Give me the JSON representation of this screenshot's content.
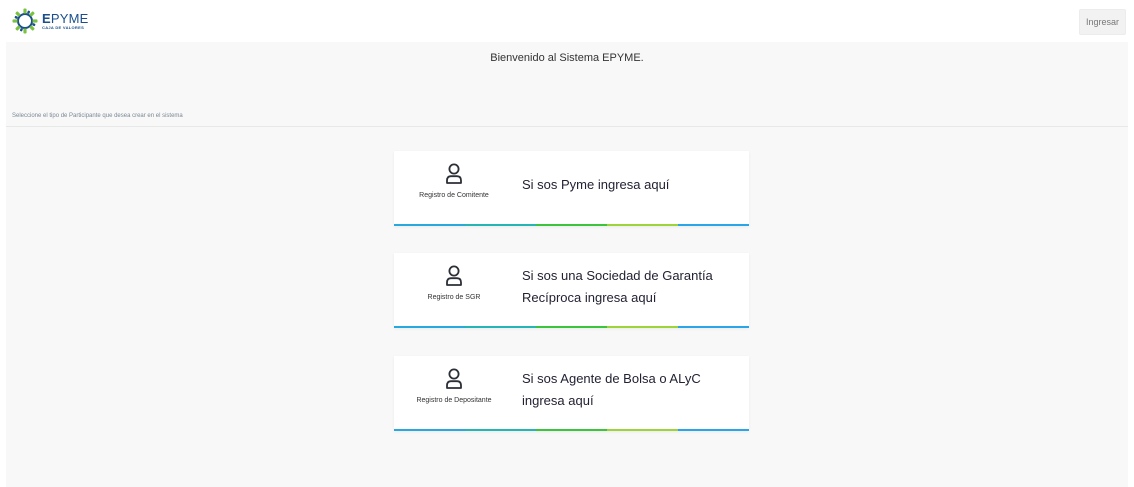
{
  "header": {
    "logo_name_bold": "E",
    "logo_name_rest": "PYME",
    "logo_sub": "CAJA DE VALORES",
    "login_label": "Ingresar"
  },
  "main": {
    "welcome": "Bienvenido al Sistema EPYME.",
    "instruction": "Seleccione el tipo de Participante que desea crear en el sistema"
  },
  "cards": [
    {
      "caption": "Registro de Comitente",
      "title_lines": [
        "Si sos Pyme ingresa aquí"
      ]
    },
    {
      "caption": "Registro de SGR",
      "title_lines": [
        "Si sos una Sociedad de Garantía",
        "Recíproca ingresa aquí"
      ]
    },
    {
      "caption": "Registro de Depositante",
      "title_lines": [
        "Si sos Agente de Bolsa o ALyC",
        "ingresa aquí"
      ]
    }
  ],
  "icons": {
    "logo": "epyme-logo-icon",
    "card": "person-icon"
  },
  "colors": {
    "brand_blue": "#1a4f8b",
    "logo_green": "#7cc242",
    "bar_cyan": "#29a8e0",
    "bar_teal": "#25b5b5",
    "bar_green": "#3cc43c",
    "bar_lime": "#9dd43a",
    "bar_blue": "#2aa6e8"
  }
}
